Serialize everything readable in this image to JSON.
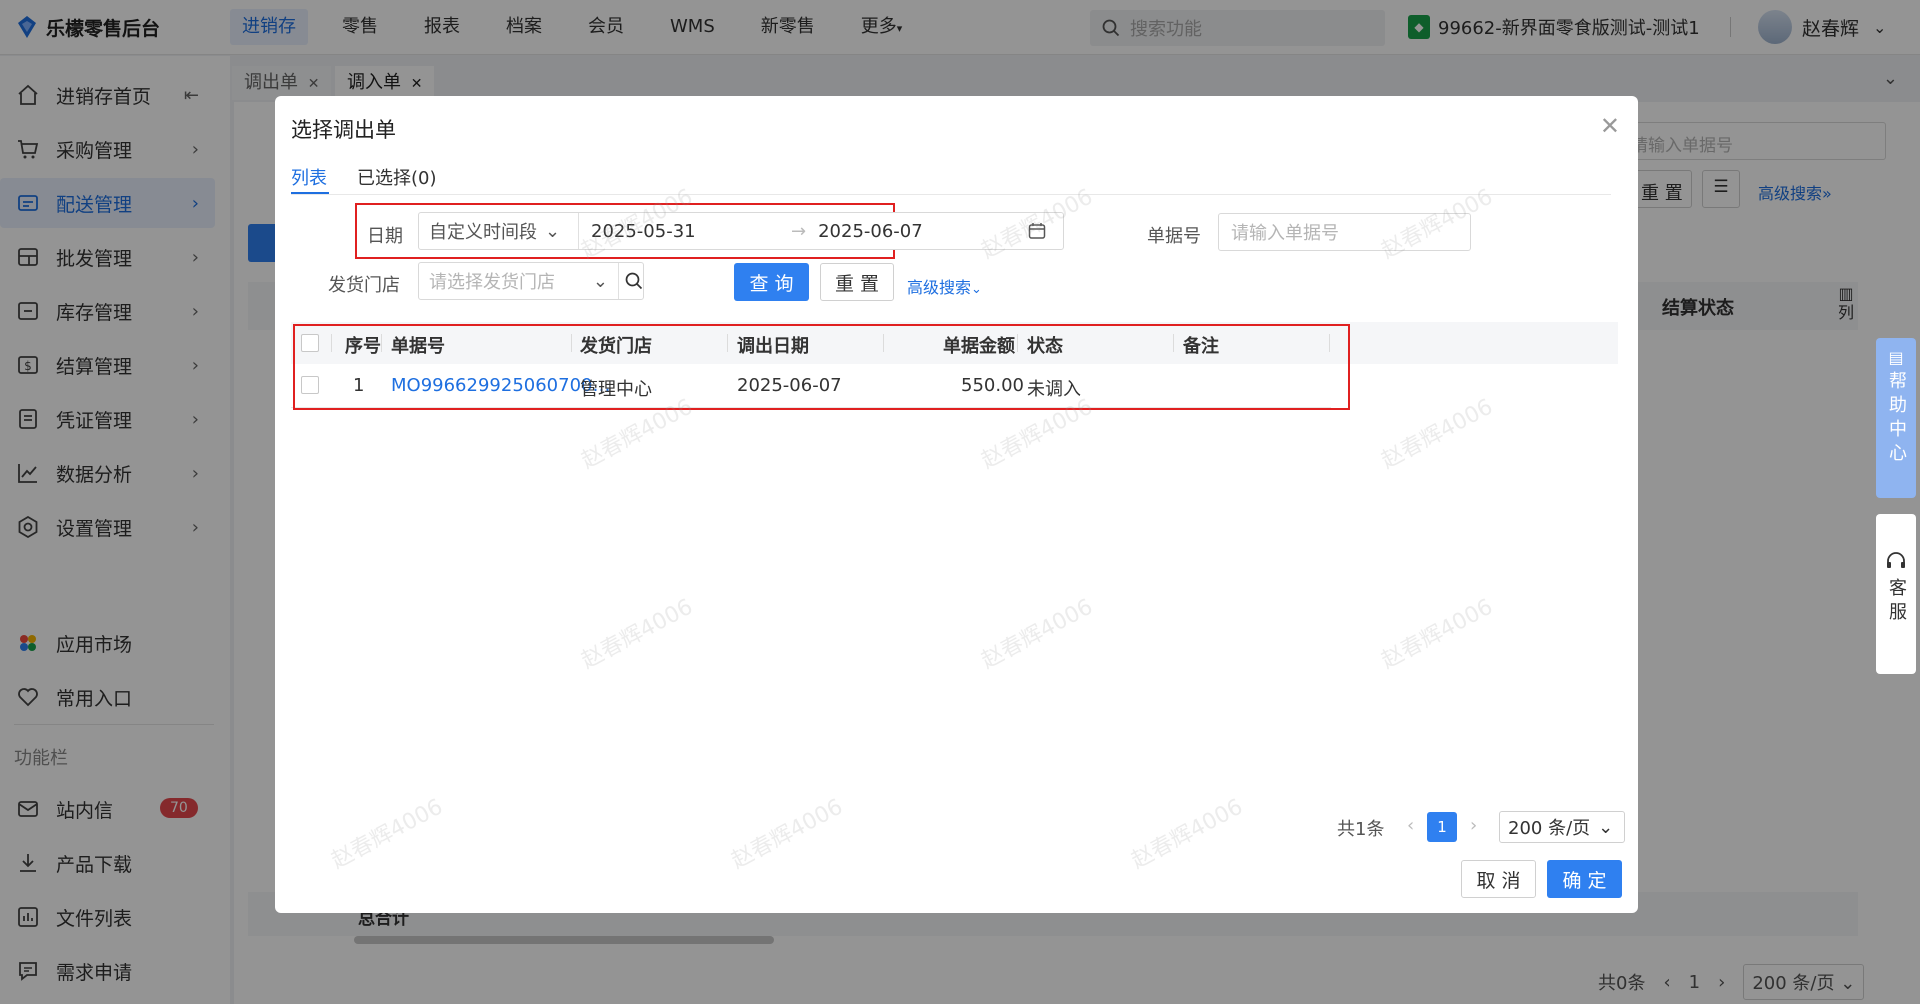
{
  "app": {
    "name": "乐檬零售后台"
  },
  "topnav": {
    "items": [
      "进销存",
      "零售",
      "报表",
      "档案",
      "会员",
      "WMS",
      "新零售",
      "更多"
    ],
    "active_index": 0
  },
  "search": {
    "placeholder": "搜索功能"
  },
  "store": {
    "name": "99662-新界面零食版测试-测试1"
  },
  "user": {
    "name": "赵春辉"
  },
  "sidebar": {
    "items": [
      "进销存首页",
      "采购管理",
      "配送管理",
      "批发管理",
      "库存管理",
      "结算管理",
      "凭证管理",
      "数据分析",
      "设置管理"
    ],
    "active_index": 2,
    "bottom_items": [
      "应用市场",
      "常用入口"
    ],
    "section_label": "功能栏",
    "function_items": [
      "站内信",
      "产品下载",
      "文件列表",
      "需求申请"
    ],
    "unread_badge": "70"
  },
  "page_tabs": [
    {
      "label": "调出单",
      "active": false
    },
    {
      "label": "调入单",
      "active": true
    }
  ],
  "background_page": {
    "search_placeholder": "请输入单据号",
    "reset_label": "重 置",
    "advanced_label": "高级搜索",
    "settle_header": "结算状态",
    "column_label": "列",
    "footer_label": "总合计",
    "total_text": "共0条",
    "page": "1",
    "page_size": "200 条/页"
  },
  "modal": {
    "title": "选择调出单",
    "tabs": [
      "列表",
      "已选择(0)"
    ],
    "active_tab": 0,
    "filters": {
      "date_label": "日期",
      "date_mode": "自定义时间段",
      "date_start": "2025-05-31",
      "date_end": "2025-06-07",
      "doc_label": "单据号",
      "doc_placeholder": "请输入单据号",
      "store_label": "发货门店",
      "store_placeholder": "请选择发货门店"
    },
    "buttons": {
      "query": "查 询",
      "reset": "重 置",
      "advanced": "高级搜索",
      "cancel": "取 消",
      "confirm": "确 定"
    },
    "table": {
      "headers": [
        "序号",
        "单据号",
        "发货门店",
        "调出日期",
        "单据金额",
        "状态",
        "备注"
      ],
      "rows": [
        {
          "index": "1",
          "doc_no": "MO996629925060700…",
          "store": "管理中心",
          "date": "2025-06-07",
          "amount": "550.00",
          "status": "未调入",
          "note": ""
        }
      ]
    },
    "pagination": {
      "total": "共1条",
      "page": "1",
      "page_size": "200 条/页"
    }
  },
  "float_help": {
    "label": "帮助中心"
  },
  "float_service": {
    "label": "客服"
  },
  "watermark": "赵春辉4006",
  "colors": {
    "primary": "#2f80f0",
    "highlight_box": "#e02020",
    "help_panel": "#8fb4f0"
  }
}
